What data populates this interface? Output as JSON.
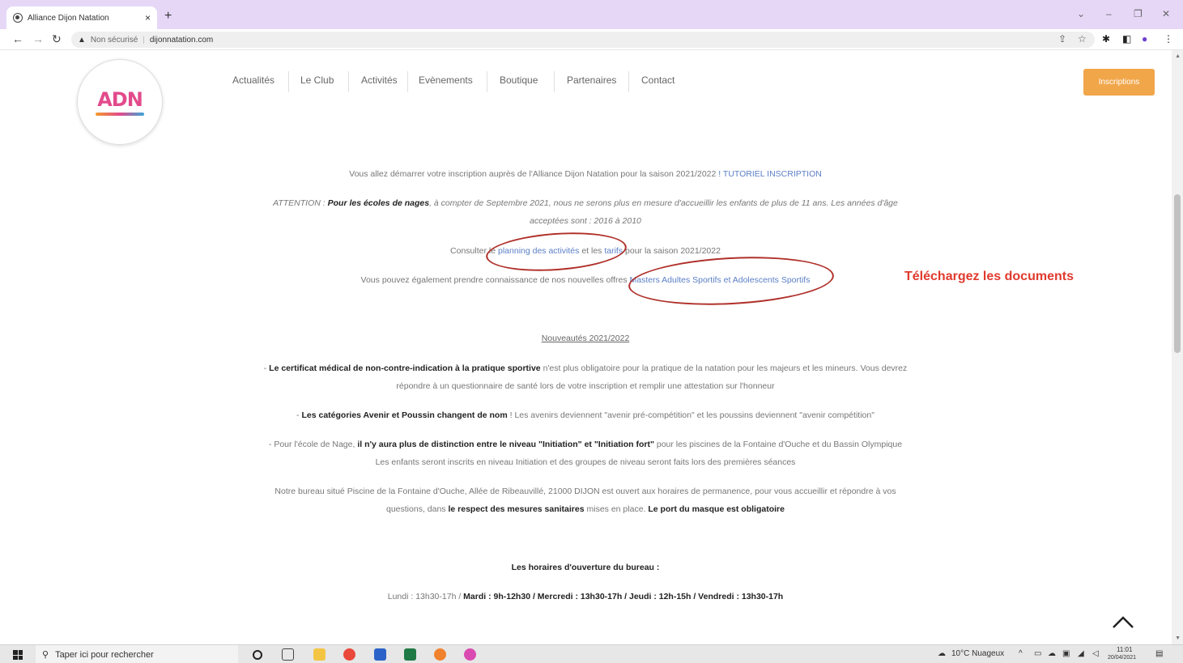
{
  "browser": {
    "tab_title": "Alliance Dijon Natation",
    "tab_close": "×",
    "new_tab": "+",
    "url_warning": "Non sécurisé",
    "url": "dijonnatation.com",
    "window_controls": [
      "⌄",
      "–",
      "❐",
      "✕"
    ]
  },
  "site": {
    "logo_text": "ADN",
    "nav": [
      "Actualités",
      "Le Club",
      "Activités",
      "Evènements",
      "Boutique",
      "Partenaires",
      "Contact"
    ],
    "cta": "Inscriptions"
  },
  "content": {
    "intro": "Vous allez démarrer votre inscription auprès de l'Alliance Dijon Natation pour la saison 2021/2022 ",
    "intro_link": "! TUTORIEL INSCRIPTION",
    "attention_prefix": "ATTENTION : ",
    "attention_bold": "Pour les écoles de nages",
    "attention_rest": ", à compter de Septembre 2021, nous ne serons plus en mesure d'accueillir les enfants de plus de 11 ans. Les années d'âge",
    "attention_line2": "acceptées sont : 2016 à 2010",
    "consult_prefix": "Consulter le ",
    "consult_link1": "planning des activités",
    "consult_mid": " et les ",
    "consult_link2": "tarifs",
    "consult_suffix": " pour la saison 2021/2022",
    "offers_prefix": "Vous pouvez également prendre connaissance de nos nouvelles offres ",
    "offers_link": "Masters Adultes Sportifs et Adolescents Sportifs",
    "annotation": "Téléchargez les documents",
    "news_heading": "Nouveautés 2021/2022",
    "cert_bold": "Le certificat médical de non-contre-indication à la pratique sportive",
    "cert_rest": " n'est plus obligatoire pour la pratique de la natation pour les majeurs et les mineurs. Vous devrez",
    "cert_line2": "répondre à un questionnaire de santé lors de votre inscription et remplir une attestation sur l'honneur",
    "cat_bold": "Les catégories Avenir et Poussin changent de nom",
    "cat_rest": " ! Les avenirs deviennent \"avenir pré-compétition\" et les poussins deviennent \"avenir compétition\"",
    "ecole_prefix": "- Pour l'école de Nage, ",
    "ecole_bold": "il n'y aura plus de distinction entre le niveau \"Initiation\" et \"Initiation fort\"",
    "ecole_rest": " pour les piscines de la Fontaine d'Ouche et du Bassin Olympique",
    "ecole_line2": "Les enfants seront inscrits en niveau Initiation et des groupes de niveau seront faits lors des premières séances",
    "bureau_line1": "Notre bureau situé Piscine de la Fontaine d'Ouche, Allée de Ribeauvillé, 21000 DIJON est ouvert aux horaires de permanence, pour vous accueillir et répondre à vos",
    "bureau_prefix2": "questions, dans ",
    "bureau_bold1": "le respect des mesures sanitaires",
    "bureau_mid2": " mises en place. ",
    "bureau_bold2": "Le port du masque est obligatoire",
    "hours_heading": "Les horaires d'ouverture du bureau :",
    "hours_prefix": "Lundi : 13h30-17h / ",
    "hours_bold": "Mardi : 9h-12h30 / Mercredi : 13h30-17h / Jeudi : 12h-15h / Vendredi : 13h30-17h"
  },
  "taskbar": {
    "search_placeholder": "Taper ici pour rechercher",
    "weather": "10°C  Nuageux",
    "time": "11:01",
    "date": "20/04/2021"
  }
}
